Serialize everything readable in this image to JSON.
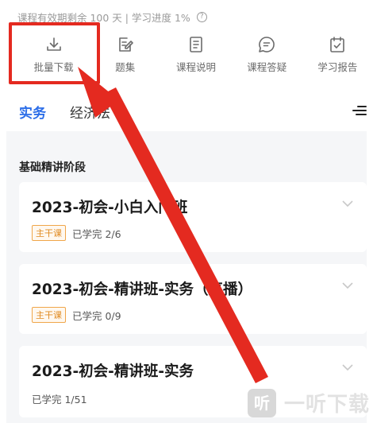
{
  "status": {
    "text": "课程有效期剩余 100 天 | 学习进度 1%",
    "help_icon": "?"
  },
  "toolbar": {
    "items": [
      {
        "label": "批量下载",
        "icon": "download-icon"
      },
      {
        "label": "题集",
        "icon": "edit-note-icon"
      },
      {
        "label": "课程说明",
        "icon": "document-icon"
      },
      {
        "label": "课程答疑",
        "icon": "chat-bubble-icon"
      },
      {
        "label": "学习报告",
        "icon": "calendar-check-icon"
      }
    ]
  },
  "tabs": [
    {
      "label": "实务",
      "active": true
    },
    {
      "label": "经济法",
      "active": false
    }
  ],
  "section": {
    "title": "基础精讲阶段"
  },
  "courses": [
    {
      "title": "2023-初会-小白入门班",
      "badge": "主干课",
      "progress": "已学完 2/6"
    },
    {
      "title": "2023-初会-精讲班-实务（直播）",
      "badge": "主干课",
      "progress": "已学完 0/9"
    },
    {
      "title": "2023-初会-精讲班-实务",
      "progress": "已学完 1/51"
    }
  ],
  "watermark": {
    "logo": "听",
    "text": "一听下载"
  },
  "colors": {
    "accent": "#2b6de8",
    "highlight": "#e42a20",
    "badge": "#e08a20"
  }
}
